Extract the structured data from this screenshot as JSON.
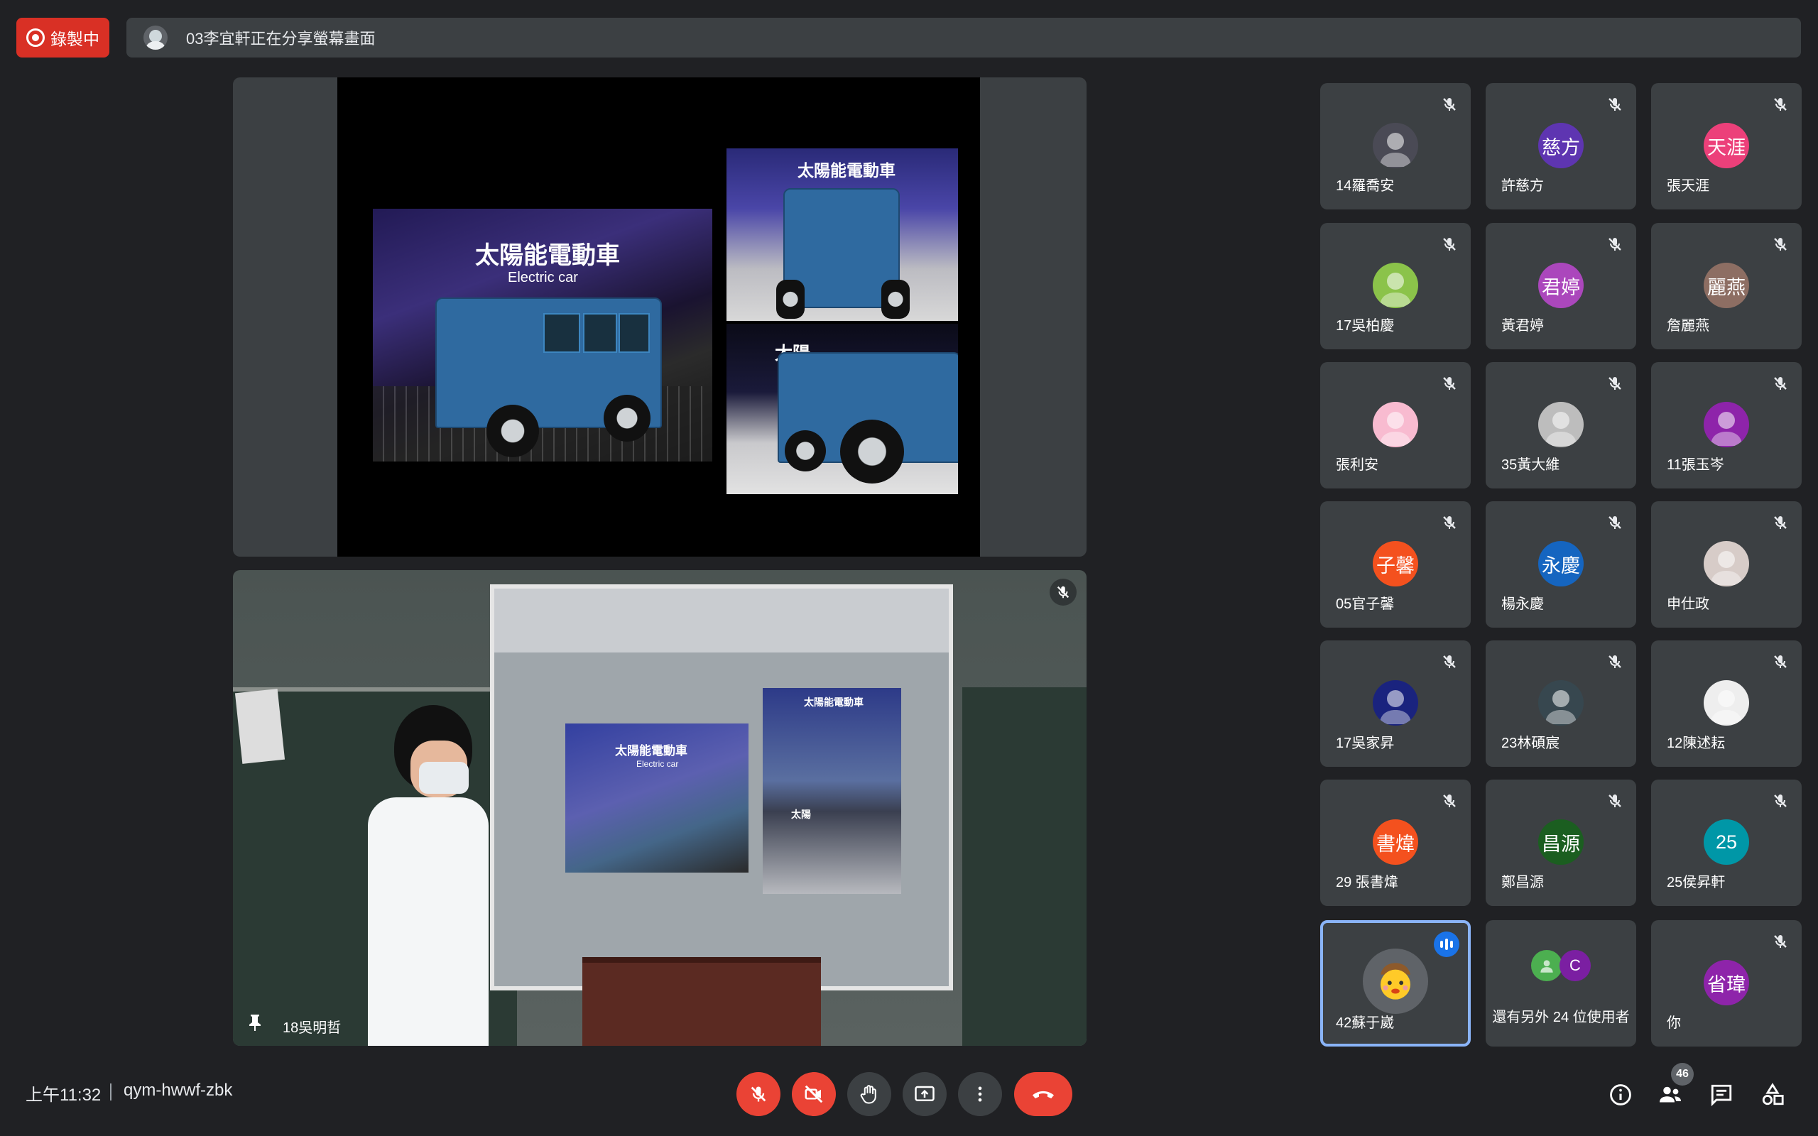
{
  "top": {
    "recording_label": "錄製中",
    "share_text": "03李宜軒正在分享螢幕畫面"
  },
  "presentation": {
    "photo_main_title": "太陽能電動車",
    "photo_main_subtitle": "Electric car",
    "photo_top_title": "太陽能電動車",
    "photo_bottom_title": "太陽"
  },
  "camera": {
    "name": "18吳明哲",
    "projection_title_a": "太陽能電動車",
    "projection_sub_a": "Electric car",
    "projection_title_b": "太陽能電動車",
    "projection_title_c": "太陽"
  },
  "participants": [
    {
      "name": "14羅喬安",
      "avatar_text": "",
      "avatar_kind": "photo",
      "color": "#4a4a55",
      "muted": true
    },
    {
      "name": "許慈方",
      "avatar_text": "慈方",
      "avatar_kind": "initials",
      "color": "#5e35b1",
      "muted": true
    },
    {
      "name": "張天涯",
      "avatar_text": "天涯",
      "avatar_kind": "initials",
      "color": "#ec407a",
      "muted": true
    },
    {
      "name": "17吳柏慶",
      "avatar_text": "",
      "avatar_kind": "photo",
      "color": "#8bc34a",
      "muted": true
    },
    {
      "name": "黃君婷",
      "avatar_text": "君婷",
      "avatar_kind": "initials",
      "color": "#ab47bc",
      "muted": true
    },
    {
      "name": "詹麗燕",
      "avatar_text": "麗燕",
      "avatar_kind": "initials",
      "color": "#8d6e63",
      "muted": true
    },
    {
      "name": "張利安",
      "avatar_text": "",
      "avatar_kind": "photo",
      "color": "#f8bbd0",
      "muted": true
    },
    {
      "name": "35黃大維",
      "avatar_text": "",
      "avatar_kind": "photo",
      "color": "#bdbdbd",
      "muted": true
    },
    {
      "name": "11張玉岑",
      "avatar_text": "",
      "avatar_kind": "photo",
      "color": "#8e24aa",
      "muted": true
    },
    {
      "name": "05官子馨",
      "avatar_text": "子馨",
      "avatar_kind": "initials",
      "color": "#f4511e",
      "muted": true
    },
    {
      "name": "楊永慶",
      "avatar_text": "永慶",
      "avatar_kind": "initials",
      "color": "#1565c0",
      "muted": true
    },
    {
      "name": "申仕政",
      "avatar_text": "",
      "avatar_kind": "photo",
      "color": "#d7ccc8",
      "muted": true
    },
    {
      "name": "17吳家昇",
      "avatar_text": "",
      "avatar_kind": "photo",
      "color": "#1a237e",
      "muted": true
    },
    {
      "name": "23林碩宸",
      "avatar_text": "",
      "avatar_kind": "photo",
      "color": "#37474f",
      "muted": true
    },
    {
      "name": "12陳述耘",
      "avatar_text": "",
      "avatar_kind": "photo",
      "color": "#eeeeee",
      "muted": true
    },
    {
      "name": "29 張書煒",
      "avatar_text": "書煒",
      "avatar_kind": "initials",
      "color": "#f4511e",
      "muted": true
    },
    {
      "name": "鄭昌源",
      "avatar_text": "昌源",
      "avatar_kind": "initials",
      "color": "#1b5e20",
      "muted": true
    },
    {
      "name": "25侯昇軒",
      "avatar_text": "25",
      "avatar_kind": "initials",
      "color": "#0097a7",
      "muted": true
    },
    {
      "name": "42蘇于崴",
      "avatar_text": "",
      "avatar_kind": "active",
      "color": "#5f6368",
      "muted": false,
      "speaking": true
    },
    {
      "name": "還有另外 24 位使用者",
      "avatar_text": "C",
      "avatar_kind": "others",
      "color": "#7b1fa2",
      "muted": false
    },
    {
      "name": "你",
      "avatar_text": "省瑋",
      "avatar_kind": "initials",
      "color": "#8e24aa",
      "muted": true
    }
  ],
  "bottom": {
    "time": "上午11:32",
    "meeting_code": "qym-hwwf-zbk",
    "participant_count": "46"
  },
  "icons": {
    "mic_off": "mic-off-icon",
    "camera_off": "videocam-off-icon",
    "raise_hand": "hand-icon",
    "present": "present-screen-icon",
    "more": "more-vert-icon",
    "hangup": "call-end-icon",
    "info": "info-icon",
    "people": "people-icon",
    "chat": "chat-icon",
    "activities": "activities-icon"
  },
  "colors": {
    "background": "#202124",
    "tile": "#3c4043",
    "danger": "#ea4335",
    "recording": "#d93025",
    "accent": "#8ab4f8"
  }
}
